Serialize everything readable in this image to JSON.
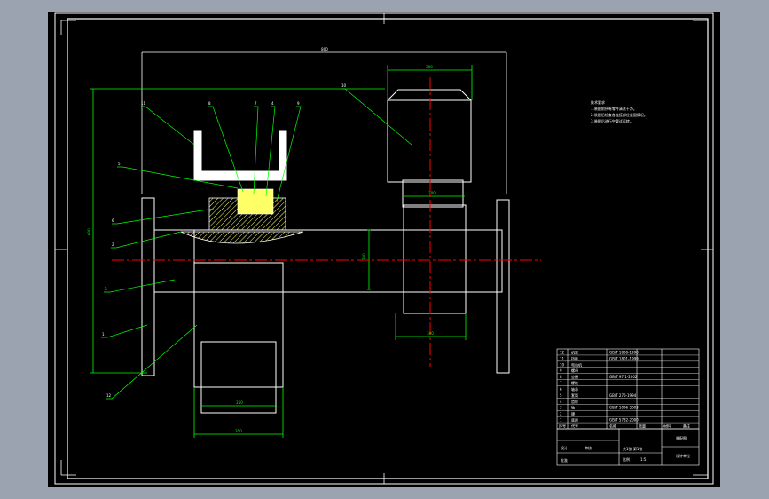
{
  "colors": {
    "background": "#9ba3b1",
    "canvas": "#000000",
    "outline": "#ffffff",
    "dimension": "#00ff00",
    "centerline": "#ff0000",
    "hatch": "#ffff66"
  },
  "dimensions": {
    "overall_width": "800",
    "overall_height": "600",
    "motor_width": "300",
    "motor_neck": "200",
    "gearbox_width": "300",
    "center_offset": "200",
    "leg_inner": "250",
    "leg_outer": "350",
    "motor_callout": "10"
  },
  "balloons": [
    "11",
    "8",
    "7",
    "4",
    "9",
    "5",
    "6",
    "2",
    "3",
    "1",
    "12"
  ],
  "technical_requirements": {
    "title": "技术要求",
    "items": [
      "1.装配前所有零件清洗干净。",
      "2.装配后检查各连接部位紧固情况。",
      "3.装配后进行空载试运转。"
    ]
  },
  "parts_list": {
    "rows": [
      {
        "no": "12",
        "name": "机架",
        "std": "GB/T 1800-1998"
      },
      {
        "no": "11",
        "name": "挡板",
        "std": "GB/T 1801-1999"
      },
      {
        "no": "10",
        "name": "电动机",
        "std": ""
      },
      {
        "no": "9",
        "name": "螺母",
        "std": ""
      },
      {
        "no": "8",
        "name": "垫圈",
        "std": "GB/T 97.1-2002"
      },
      {
        "no": "7",
        "name": "螺栓",
        "std": ""
      },
      {
        "no": "6",
        "name": "轴承",
        "std": ""
      },
      {
        "no": "5",
        "name": "套筒",
        "std": "GB/T 276-1994"
      },
      {
        "no": "4",
        "name": "齿轮",
        "std": ""
      },
      {
        "no": "3",
        "name": "轴",
        "std": "GB/T 1096-2003"
      },
      {
        "no": "2",
        "name": "键",
        "std": ""
      },
      {
        "no": "1",
        "name": "底座",
        "std": "GB/T 5782-2000"
      }
    ],
    "header": [
      "序号",
      "代号",
      "名称",
      "数量",
      "材料",
      "备注"
    ]
  },
  "title_block": {
    "drawing_name": "装配图",
    "company": "设计单位",
    "scale_label": "比例",
    "scale": "1:5",
    "sheet_label": "共1张 第1张",
    "designer_label": "设计",
    "checker_label": "审核",
    "approver_label": "批准"
  }
}
